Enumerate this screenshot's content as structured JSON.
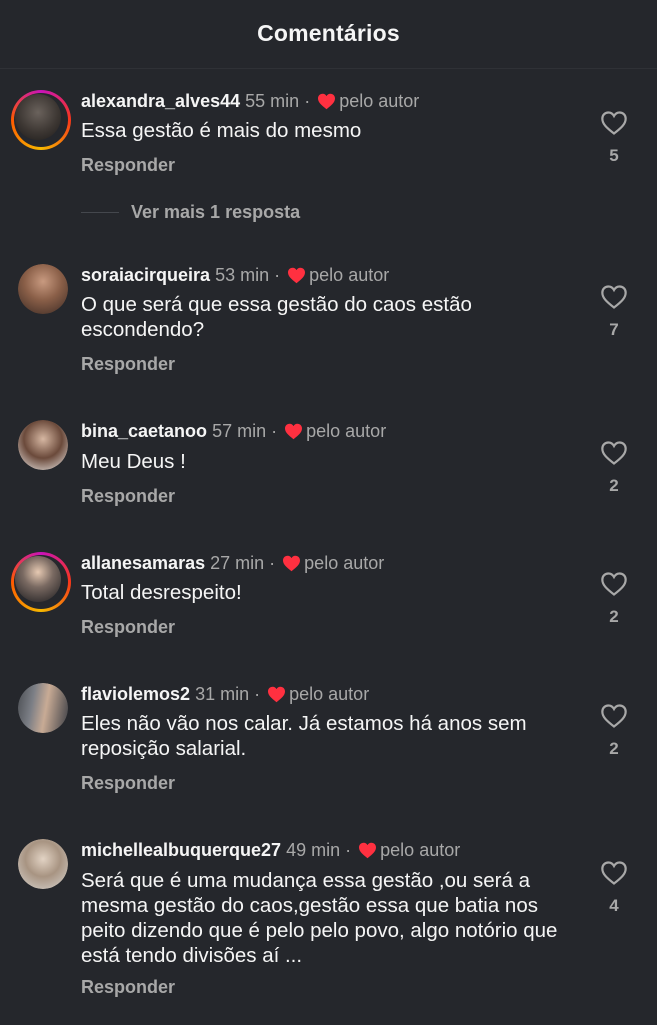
{
  "header": {
    "title": "Comentários"
  },
  "common": {
    "reply_label": "Responder",
    "author_label": "pelo autor",
    "dot": "·"
  },
  "comments": [
    {
      "username": "alexandra_alves44",
      "time": "55 min",
      "text": "Essa gestão é mais do mesmo",
      "likes": "5",
      "story_ring": true,
      "more_replies": "Ver mais 1 resposta"
    },
    {
      "username": "soraiacirqueira",
      "time": "53 min",
      "text": "O que será que essa gestão do caos estão escondendo?",
      "likes": "7",
      "story_ring": false
    },
    {
      "username": "bina_caetanoo",
      "time": "57 min",
      "text": "Meu Deus !",
      "likes": "2",
      "story_ring": false
    },
    {
      "username": "allanesamaras",
      "time": "27 min",
      "text": "Total desrespeito!",
      "likes": "2",
      "story_ring": true
    },
    {
      "username": "flaviolemos2",
      "time": "31 min",
      "text": "Eles não vão nos calar. Já estamos há anos sem reposição salarial.",
      "likes": "2",
      "story_ring": false
    },
    {
      "username": "michellealbuquerque27",
      "time": "49 min",
      "text": "Será que é uma mudança essa gestão ,ou será a mesma gestão do caos,gestão essa que batia nos peito dizendo que é pelo pelo povo, algo notório que está tendo divisões aí ...",
      "likes": "4",
      "story_ring": false
    }
  ],
  "colors": {
    "background": "#25272c",
    "heart_red": "#ff3040",
    "muted_text": "#a8a8a8"
  }
}
